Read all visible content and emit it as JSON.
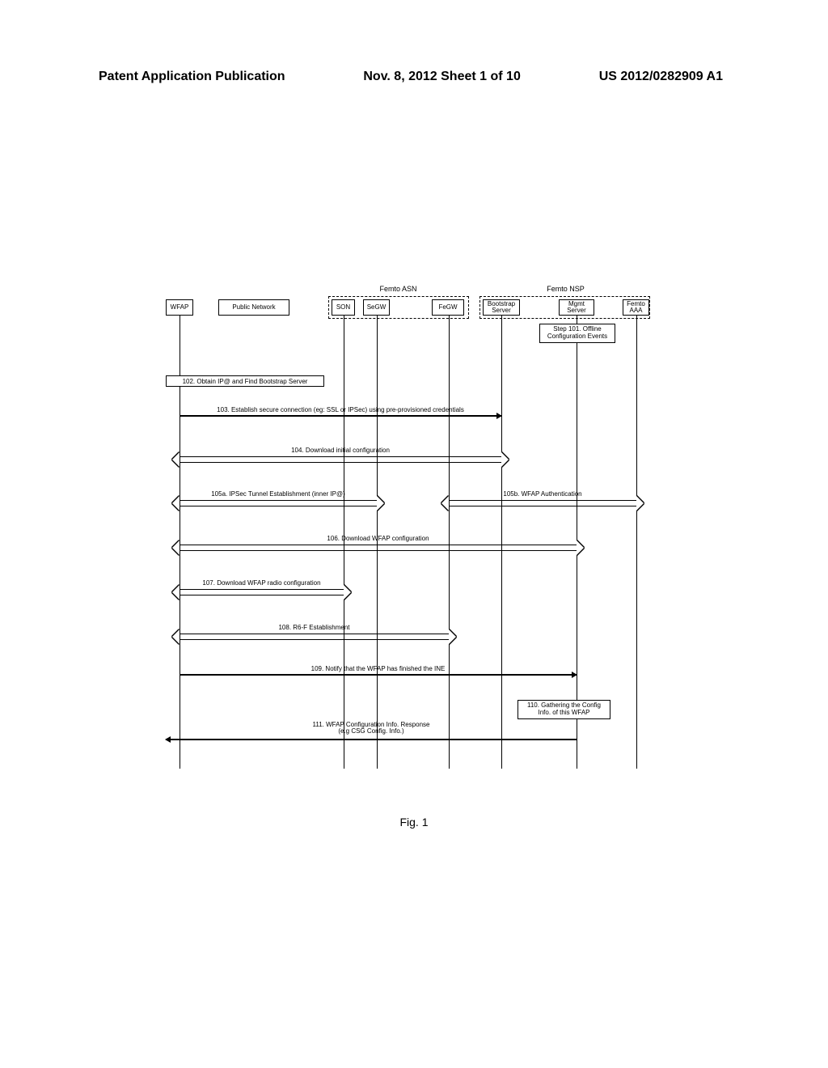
{
  "header": {
    "left": "Patent Application Publication",
    "center": "Nov. 8, 2012   Sheet 1 of 10",
    "right": "US 2012/0282909 A1"
  },
  "groups": {
    "asn": "Femto ASN",
    "nsp": "Femto NSP"
  },
  "nodes": {
    "wfap": "WFAP",
    "public": "Public Network",
    "son": "SON",
    "segw": "SeGW",
    "fegw": "FeGW",
    "boot": "Bootstrap\nServer",
    "mgmt": "Mgmt\nServer",
    "aaa": "Femto\nAAA"
  },
  "steps": {
    "s101": "Step 101. Offline\nConfiguration Events",
    "s102": "102. Obtain IP@ and Find Bootstrap Server",
    "s103": "103. Establish secure connection (eg: SSL or IPSec) using pre-provisioned credentials",
    "s104": "104. Download initial configuration",
    "s105a": "105a. IPSec Tunnel Establishment (inner IP@)",
    "s105b": "105b. WFAP Authentication",
    "s106": "106. Download WFAP configuration",
    "s107": "107. Download WFAP radio configuration",
    "s108": "108. R6-F Establishment",
    "s109": "109. Notify that the WFAP has finished the INE",
    "s110": "110. Gathering the Config\nInfo. of this WFAP",
    "s111": "111. WFAP Configuration Info. Response\n(e.g CSG Config. Info.)"
  },
  "caption": "Fig. 1",
  "chart_data": {
    "type": "table",
    "description": "Sequence diagram",
    "participants": [
      "WFAP",
      "Public Network",
      "SON",
      "SeGW",
      "FeGW",
      "Bootstrap Server",
      "Mgmt Server",
      "Femto AAA"
    ],
    "messages": [
      {
        "id": "101",
        "text": "Step 101. Offline Configuration Events",
        "kind": "note",
        "at": [
          "Mgmt Server",
          "Femto AAA"
        ]
      },
      {
        "id": "102",
        "text": "102. Obtain IP@ and Find Bootstrap Server",
        "kind": "note",
        "at": [
          "WFAP",
          "Public Network"
        ]
      },
      {
        "id": "103",
        "text": "103. Establish secure connection (eg: SSL or IPSec) using pre-provisioned credentials",
        "from": "WFAP",
        "to": "Bootstrap Server",
        "kind": "arrow-right"
      },
      {
        "id": "104",
        "text": "104. Download initial configuration",
        "from": "WFAP",
        "to": "Bootstrap Server",
        "kind": "double"
      },
      {
        "id": "105a",
        "text": "105a. IPSec Tunnel Establishment (inner IP@)",
        "from": "WFAP",
        "to": "SeGW",
        "kind": "double"
      },
      {
        "id": "105b",
        "text": "105b. WFAP Authentication",
        "from": "SeGW",
        "to": "Femto AAA",
        "kind": "double"
      },
      {
        "id": "106",
        "text": "106. Download WFAP configuration",
        "from": "WFAP",
        "to": "Mgmt Server",
        "kind": "double"
      },
      {
        "id": "107",
        "text": "107. Download WFAP radio configuration",
        "from": "WFAP",
        "to": "SON",
        "kind": "double"
      },
      {
        "id": "108",
        "text": "108. R6-F Establishment",
        "from": "WFAP",
        "to": "FeGW",
        "kind": "double"
      },
      {
        "id": "109",
        "text": "109. Notify that the WFAP has finished the INE",
        "from": "WFAP",
        "to": "Mgmt Server",
        "kind": "arrow-right"
      },
      {
        "id": "110",
        "text": "110. Gathering the Config Info. of this WFAP",
        "kind": "note",
        "at": [
          "Mgmt Server"
        ]
      },
      {
        "id": "111",
        "text": "111. WFAP Configuration Info. Response (e.g CSG Config. Info.)",
        "from": "Mgmt Server",
        "to": "WFAP",
        "kind": "arrow-left"
      }
    ]
  }
}
